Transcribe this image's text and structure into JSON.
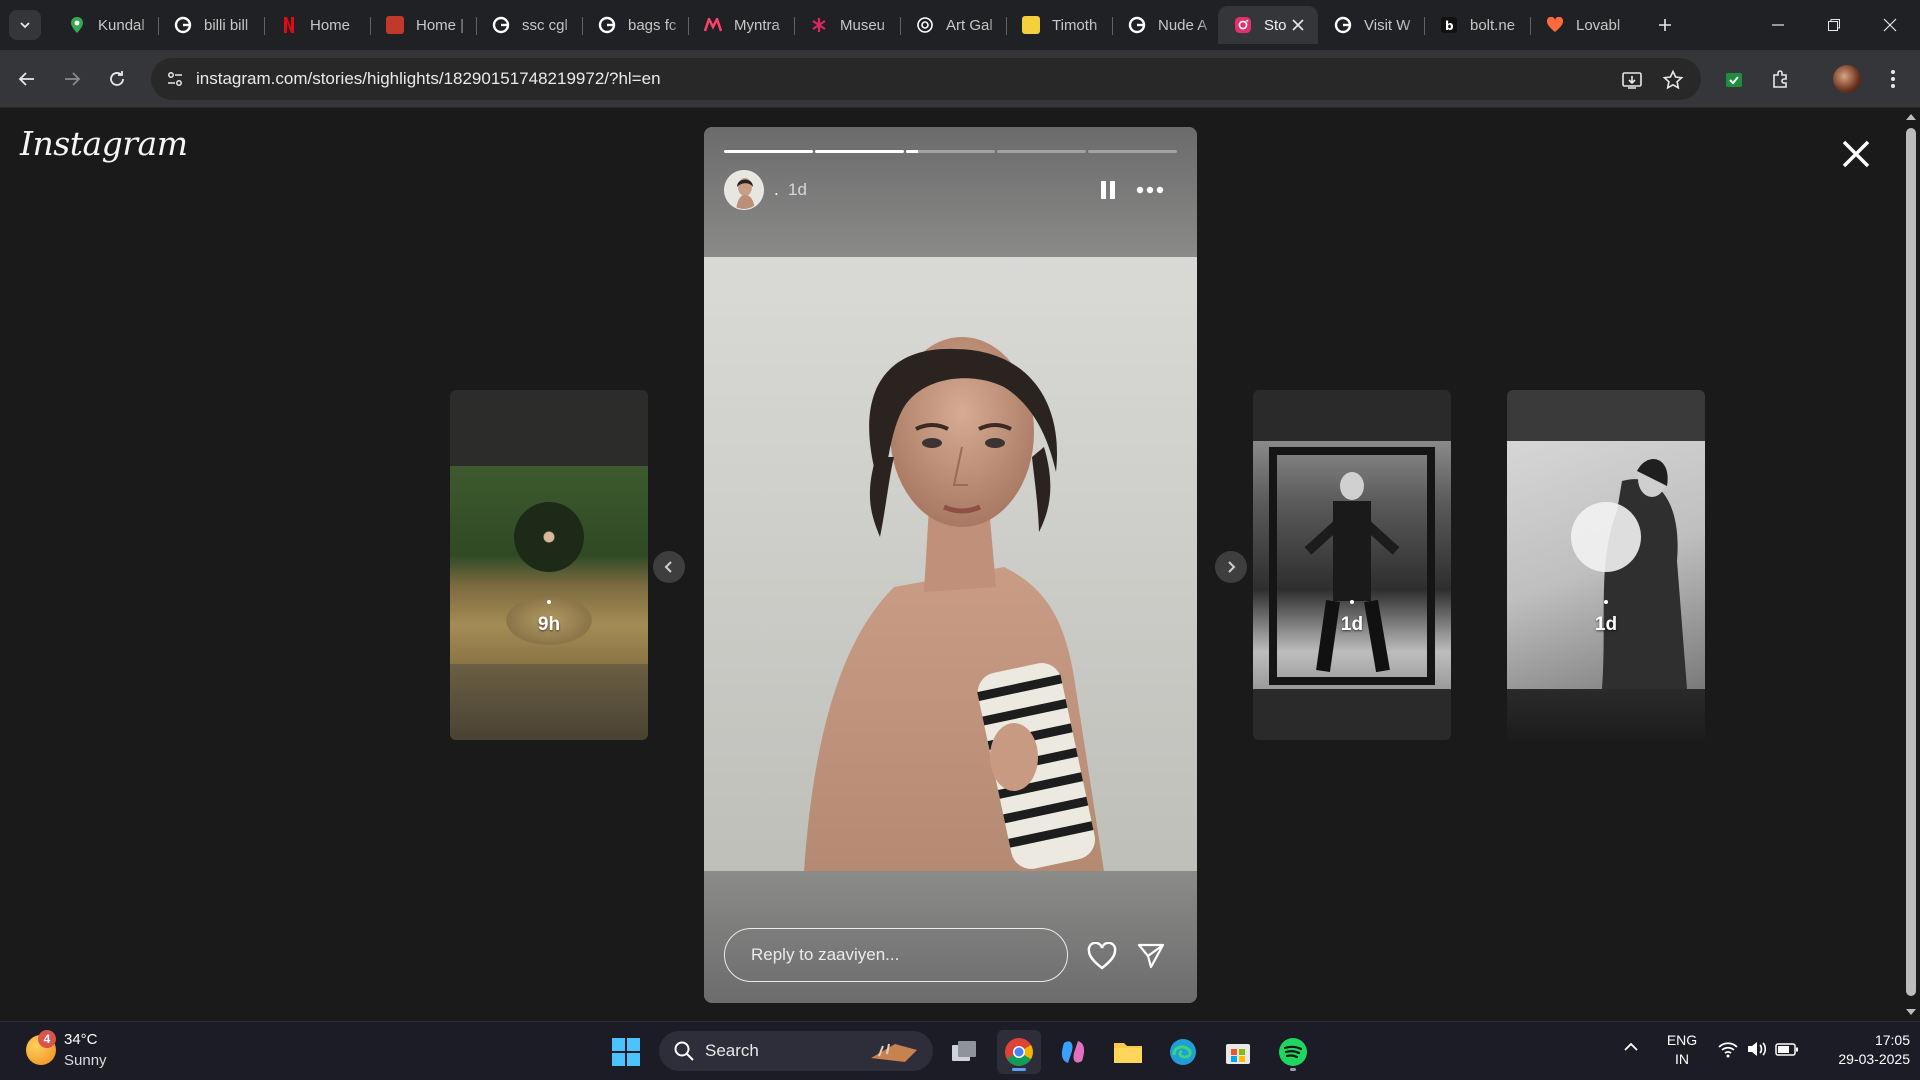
{
  "browser": {
    "tabs": [
      {
        "title": "Kundal",
        "icon": "maps-pin-icon",
        "color": "#34a853"
      },
      {
        "title": "billi bill",
        "icon": "google-icon",
        "color": "#ffffff"
      },
      {
        "title": "Home",
        "icon": "netflix-icon",
        "color": "#e50914"
      },
      {
        "title": "Home |",
        "icon": "site-icon",
        "color": "#c0392b"
      },
      {
        "title": "ssc cgl",
        "icon": "google-icon",
        "color": "#ffffff"
      },
      {
        "title": "bags fc",
        "icon": "google-icon",
        "color": "#ffffff"
      },
      {
        "title": "Myntra",
        "icon": "myntra-icon",
        "color": "#ff3f6c"
      },
      {
        "title": "Museu",
        "icon": "asterisk-icon",
        "color": "#e0245e"
      },
      {
        "title": "Art Gal",
        "icon": "openai-icon",
        "color": "#ffffff"
      },
      {
        "title": "Timoth",
        "icon": "site-icon",
        "color": "#f4d03f"
      },
      {
        "title": "Nude A",
        "icon": "google-icon",
        "color": "#ffffff"
      },
      {
        "title": "Sto",
        "icon": "instagram-icon",
        "color": "#e1306c",
        "active": true
      },
      {
        "title": "Visit W",
        "icon": "google-icon",
        "color": "#ffffff"
      },
      {
        "title": "bolt.ne",
        "icon": "bolt-icon",
        "color": "#ffffff"
      },
      {
        "title": "Lovabl",
        "icon": "heart-icon",
        "color": "#ff6a3d"
      }
    ],
    "url": "instagram.com/stories/highlights/18290151748219972/?hl=en"
  },
  "instagram": {
    "logo": "Instagram",
    "story": {
      "username": ".",
      "time": "1d",
      "progress": [
        1,
        1,
        0.13,
        0,
        0
      ],
      "reply_placeholder": "Reply to zaaviyen..."
    },
    "side_stories": [
      {
        "time": "9h",
        "position": "left"
      },
      {
        "time": "1d",
        "position": "right-1"
      },
      {
        "time": "1d",
        "position": "right-2"
      }
    ]
  },
  "taskbar": {
    "weather": {
      "temp": "34°C",
      "condition": "Sunny",
      "badge": "4"
    },
    "search_label": "Search",
    "lang_line1": "ENG",
    "lang_line2": "IN",
    "time": "17:05",
    "date": "29-03-2025"
  }
}
